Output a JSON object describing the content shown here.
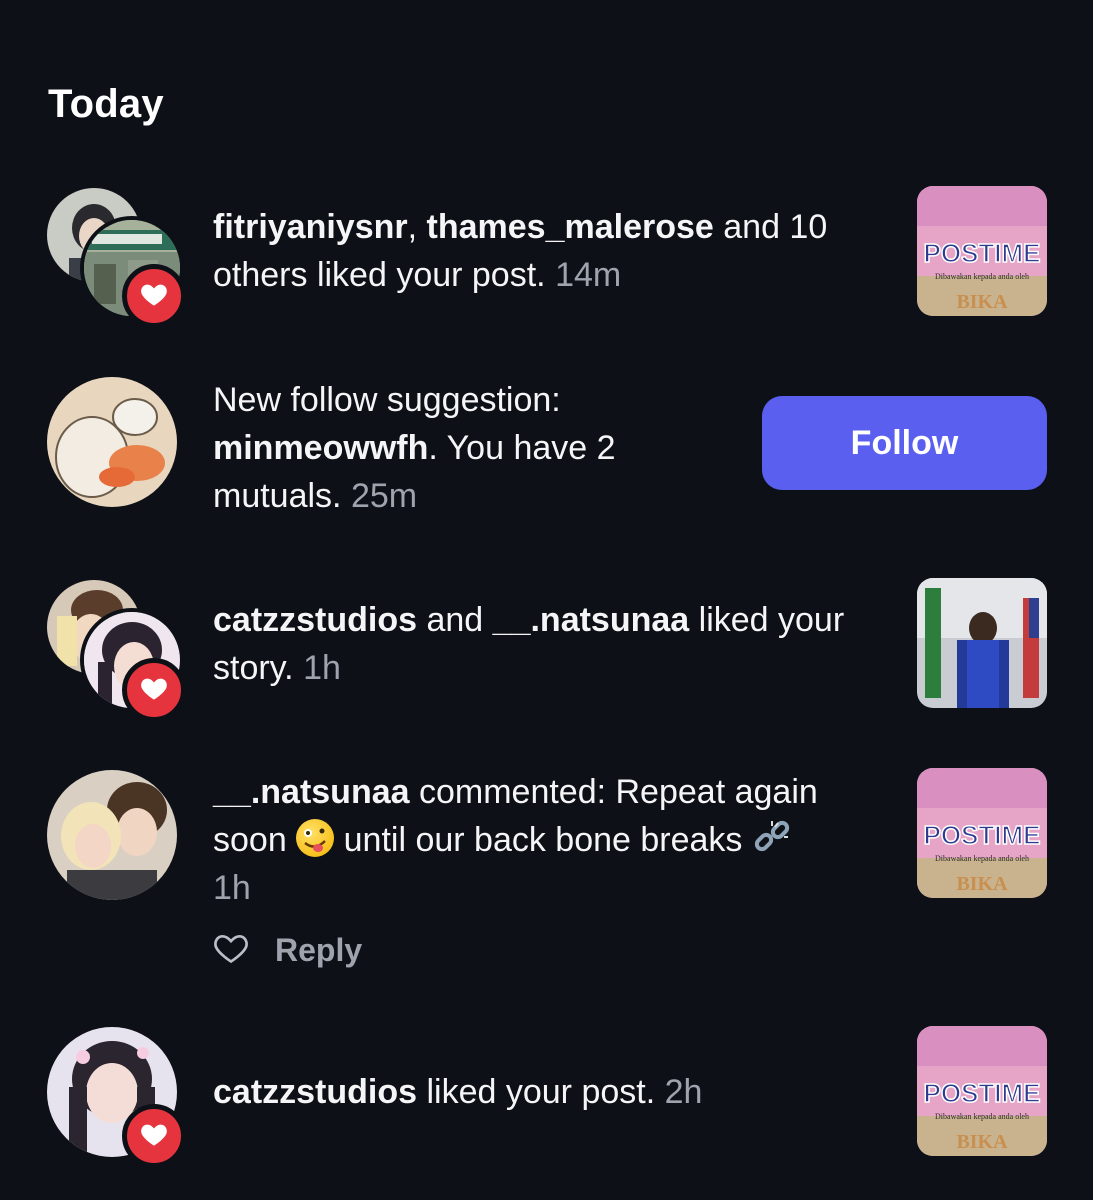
{
  "section": {
    "title": "Today"
  },
  "notifications": [
    {
      "type": "like_post",
      "user1": "fitriyaniysnr",
      "sep1": ", ",
      "user2": "thames_malerose",
      "text_after": " and 10 others liked your post.",
      "time": "14m",
      "avatar_icon": "heart-icon",
      "thumbnail": "post-thumbnail"
    },
    {
      "type": "follow_suggestion",
      "text_before": "New follow suggestion:",
      "user": "minmeowwfh",
      "text_after": ". You have 2 mutuals.",
      "time": "25m",
      "button_label": "Follow"
    },
    {
      "type": "like_story",
      "user1": "catzzstudios",
      "between": " and ",
      "user2": "__.natsunaa",
      "text_after": " liked your story.",
      "time": "1h",
      "thumbnail": "story-thumbnail"
    },
    {
      "type": "comment",
      "user": "__.natsunaa",
      "text_a": " commented: Repeat again soon ",
      "emoji1": "zany-face-emoji",
      "text_b": " until our back bone breaks ",
      "emoji2": "broken-chain-emoji",
      "time": "1h",
      "reply_label": "Reply"
    },
    {
      "type": "like_post",
      "user": "catzzstudios",
      "text_after": " liked your post.",
      "time": "2h"
    }
  ],
  "thumbnail_text": {
    "headline": "POSTIME",
    "subline": "Dibawakan kepada anda oleh",
    "footer": "BIKA"
  },
  "colors": {
    "background": "#0d1117",
    "follow_button": "#5b5ff0",
    "heart_badge": "#e5343d",
    "muted_text": "#9ea3ad"
  }
}
